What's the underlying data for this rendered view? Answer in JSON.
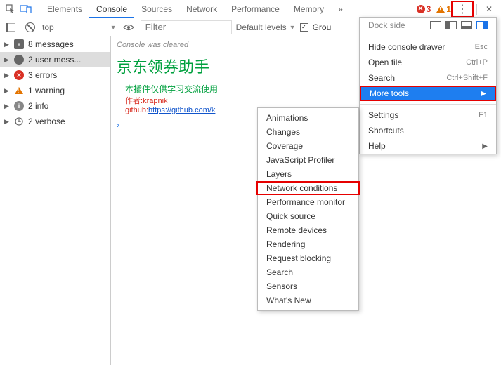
{
  "toolbar": {
    "tabs": [
      "Elements",
      "Console",
      "Sources",
      "Network",
      "Performance",
      "Memory"
    ],
    "activeTab": "Console",
    "errorCount": "3",
    "warnCount": "1"
  },
  "filterbar": {
    "context": "top",
    "filterPlaceholder": "Filter",
    "levels": "Default levels",
    "groupLabel": "Grou"
  },
  "sidebar": {
    "items": [
      {
        "label": "8 messages"
      },
      {
        "label": "2 user mess..."
      },
      {
        "label": "3 errors"
      },
      {
        "label": "1 warning"
      },
      {
        "label": "2 info"
      },
      {
        "label": "2 verbose"
      }
    ]
  },
  "console": {
    "cleared": "Console was cleared",
    "src1": "raw?blob",
    "src2": "raw?blob",
    "src3": "raw?blob",
    "title": "京东领券助手",
    "note": "本插件仅供学习交流使用",
    "authorLabel": "作者:",
    "author": "krapnik",
    "ghLabel": "github:",
    "ghUrl": "https://github.com/k"
  },
  "menu": {
    "dockLabel": "Dock side",
    "hideDrawer": {
      "label": "Hide console drawer",
      "shortcut": "Esc"
    },
    "openFile": {
      "label": "Open file",
      "shortcut": "Ctrl+P"
    },
    "search": {
      "label": "Search",
      "shortcut": "Ctrl+Shift+F"
    },
    "moreTools": "More tools",
    "settings": {
      "label": "Settings",
      "shortcut": "F1"
    },
    "shortcuts": "Shortcuts",
    "help": "Help"
  },
  "submenu": {
    "items": [
      "Animations",
      "Changes",
      "Coverage",
      "JavaScript Profiler",
      "Layers",
      "Network conditions",
      "Performance monitor",
      "Quick source",
      "Remote devices",
      "Rendering",
      "Request blocking",
      "Search",
      "Sensors",
      "What's New"
    ]
  }
}
